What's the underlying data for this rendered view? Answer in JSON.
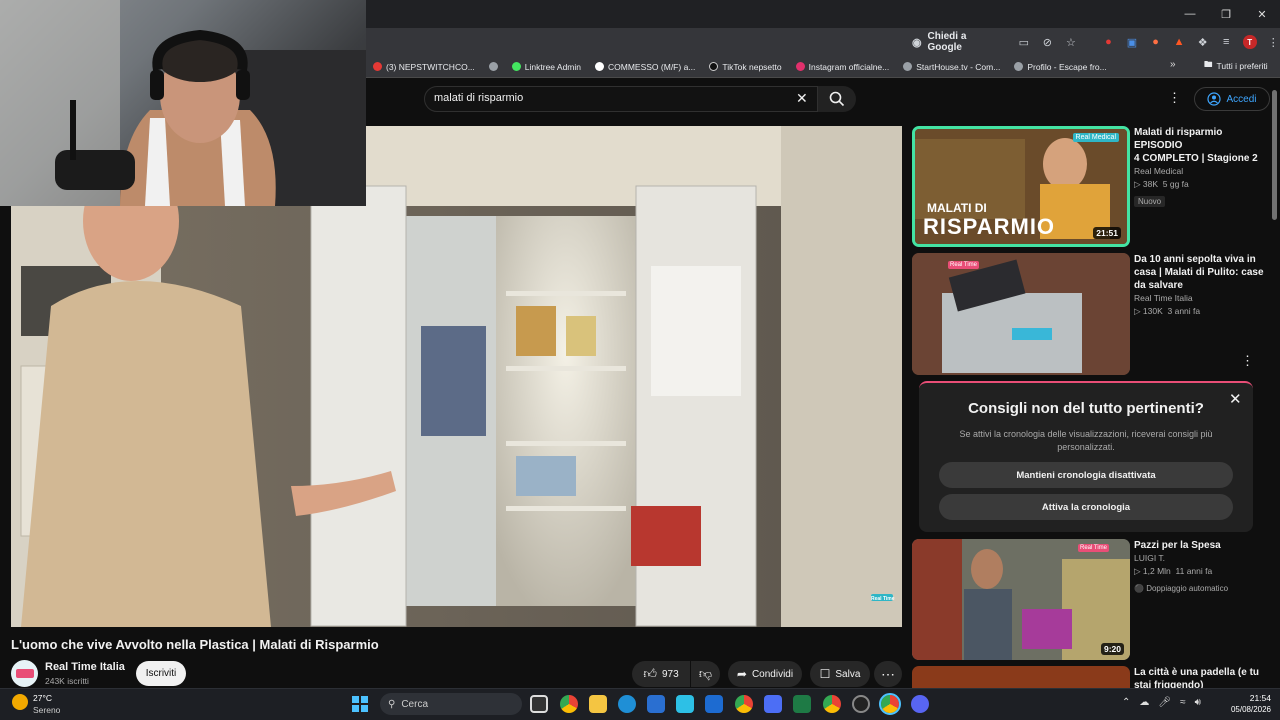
{
  "browser": {
    "ask_google": "Chiedi a Google",
    "bookmarks": [
      {
        "label": "(3) NEPSTWITCHCO...",
        "color": "#e53935"
      },
      {
        "label": "",
        "color": "#9aa0a6"
      },
      {
        "label": "Linktree Admin",
        "color": "#43e660"
      },
      {
        "label": "COMMESSO (M/F) a...",
        "color": "#ffffff"
      },
      {
        "label": "TikTok nepsetto",
        "color": "#000000"
      },
      {
        "label": "Instagram officialne...",
        "color": "#e1306c"
      },
      {
        "label": "StartHouse.tv - Com...",
        "color": "#9aa0a6"
      },
      {
        "label": "Profilo - Escape fro...",
        "color": "#9aa0a6"
      }
    ],
    "more": "»",
    "all_bookmarks": "Tutti i preferiti"
  },
  "youtube": {
    "search_query": "malati di risparmio",
    "sign_in": "Accedi",
    "video": {
      "title": "L'uomo che vive Avvolto nella Plastica | Malati di Risparmio",
      "channel": "Real Time Italia",
      "subscribers": "243K iscritti",
      "subscribe_label": "Iscriviti",
      "likes": "973",
      "share_label": "Condividi",
      "save_label": "Salva",
      "watermark": "Real Time"
    },
    "sidebar": [
      {
        "title_lines": [
          "Malati di risparmio EPISODIO",
          "4 COMPLETO | Stagione 2"
        ],
        "channel": "Real Medical",
        "views": "38K",
        "age": "5 gg fa",
        "badge": "Nuovo",
        "duration": "21:51",
        "thumb_text": "MALATI DI",
        "thumb_text2": "RISPARMIO",
        "thumb_tag": "Real Medical"
      },
      {
        "title_lines": [
          "Da 10 anni sepolta viva in",
          "casa | Malati di Pulito: case",
          "da salvare"
        ],
        "channel": "Real Time Italia",
        "views": "130K",
        "age": "3 anni fa",
        "thumb_tag": "Real Time"
      },
      {
        "title_lines": [
          "Pazzi per la Spesa"
        ],
        "channel": "LUIGI T.",
        "views": "1,2 Mln",
        "age": "11 anni fa",
        "badge": "Doppiaggio automatico",
        "duration": "9:20",
        "thumb_tag": "Real Time"
      },
      {
        "title_lines": [
          "La città è una padella (e tu",
          "stai friggendo)"
        ]
      }
    ],
    "card": {
      "title": "Consigli non del tutto pertinenti?",
      "description_lines": [
        "Se attivi la cronologia delle visualizzazioni, riceverai consigli più",
        "personalizzati."
      ],
      "button_keep": "Mantieni cronologia disattivata",
      "button_enable": "Attiva la cronologia"
    }
  },
  "taskbar": {
    "temperature": "27°C",
    "condition": "Sereno",
    "search_placeholder": "Cerca",
    "time": "21:54",
    "date": "05/08/2026"
  }
}
